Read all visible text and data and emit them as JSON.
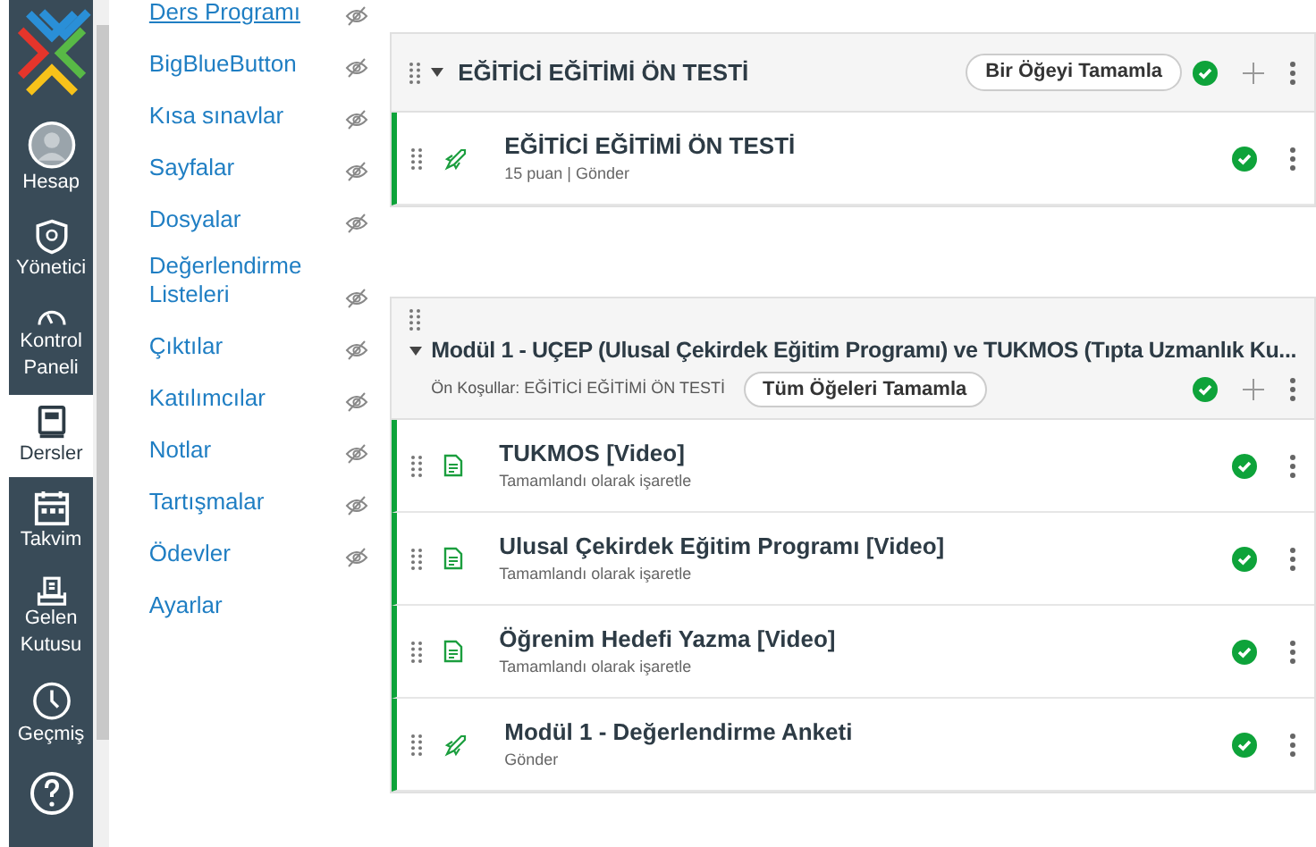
{
  "global_nav": [
    {
      "label": "Hesap",
      "selected": false
    },
    {
      "label": "Yönetici",
      "selected": false
    },
    {
      "label": "Kontrol Paneli",
      "selected": false
    },
    {
      "label": "Dersler",
      "selected": true
    },
    {
      "label": "Takvim",
      "selected": false
    },
    {
      "label": "Gelen Kutusu",
      "selected": false
    },
    {
      "label": "Geçmiş",
      "selected": false
    },
    {
      "selected": false
    }
  ],
  "course_nav": [
    {
      "label": "Ders Programı",
      "hidden": true,
      "underlined": true
    },
    {
      "label": "BigBlueButton",
      "hidden": true,
      "underlined": false
    },
    {
      "label": "Kısa sınavlar",
      "hidden": true,
      "underlined": false
    },
    {
      "label": "Sayfalar",
      "hidden": true,
      "underlined": false
    },
    {
      "label": "Dosyalar",
      "hidden": true,
      "underlined": false
    },
    {
      "label": "Değerlendirme Listeleri",
      "hidden": true,
      "underlined": false
    },
    {
      "label": "Çıktılar",
      "hidden": true,
      "underlined": false
    },
    {
      "label": "Katılımcılar",
      "hidden": true,
      "underlined": false
    },
    {
      "label": "Notlar",
      "hidden": true,
      "underlined": false
    },
    {
      "label": "Tartışmalar",
      "hidden": true,
      "underlined": false
    },
    {
      "label": "Ödevler",
      "hidden": true,
      "underlined": false
    },
    {
      "label": "Ayarlar",
      "hidden": false,
      "underlined": false
    }
  ],
  "modules": [
    {
      "title": "EĞİTİCİ EĞİTİMİ ÖN TESTİ",
      "requirement": "Bir Öğeyi Tamamla",
      "completed": true,
      "items": [
        {
          "kind": "quiz",
          "title": "EĞİTİCİ EĞİTİMİ ÖN TESTİ",
          "details": "15 puan | Gönder",
          "completed": true
        }
      ]
    },
    {
      "title": "Modül 1 - UÇEP (Ulusal Çekirdek Eğitim Programı) ve TUKMOS (Tıpta Uzmanlık Ku...",
      "prerequisites": "Ön Koşullar: EĞİTİCİ EĞİTİMİ ÖN TESTİ",
      "requirement": "Tüm Öğeleri Tamamla",
      "completed": true,
      "items": [
        {
          "kind": "page",
          "title": "TUKMOS [Video]",
          "details": "Tamamlandı olarak işaretle",
          "completed": true
        },
        {
          "kind": "page",
          "title": "Ulusal Çekirdek Eğitim Programı [Video]",
          "details": "Tamamlandı olarak işaretle",
          "completed": true
        },
        {
          "kind": "page",
          "title": "Öğrenim Hedefi Yazma [Video]",
          "details": "Tamamlandı olarak işaretle",
          "completed": true
        },
        {
          "kind": "quiz",
          "title": "Modül 1 - Değerlendirme Anketi",
          "details": "Gönder",
          "completed": true
        }
      ]
    }
  ]
}
